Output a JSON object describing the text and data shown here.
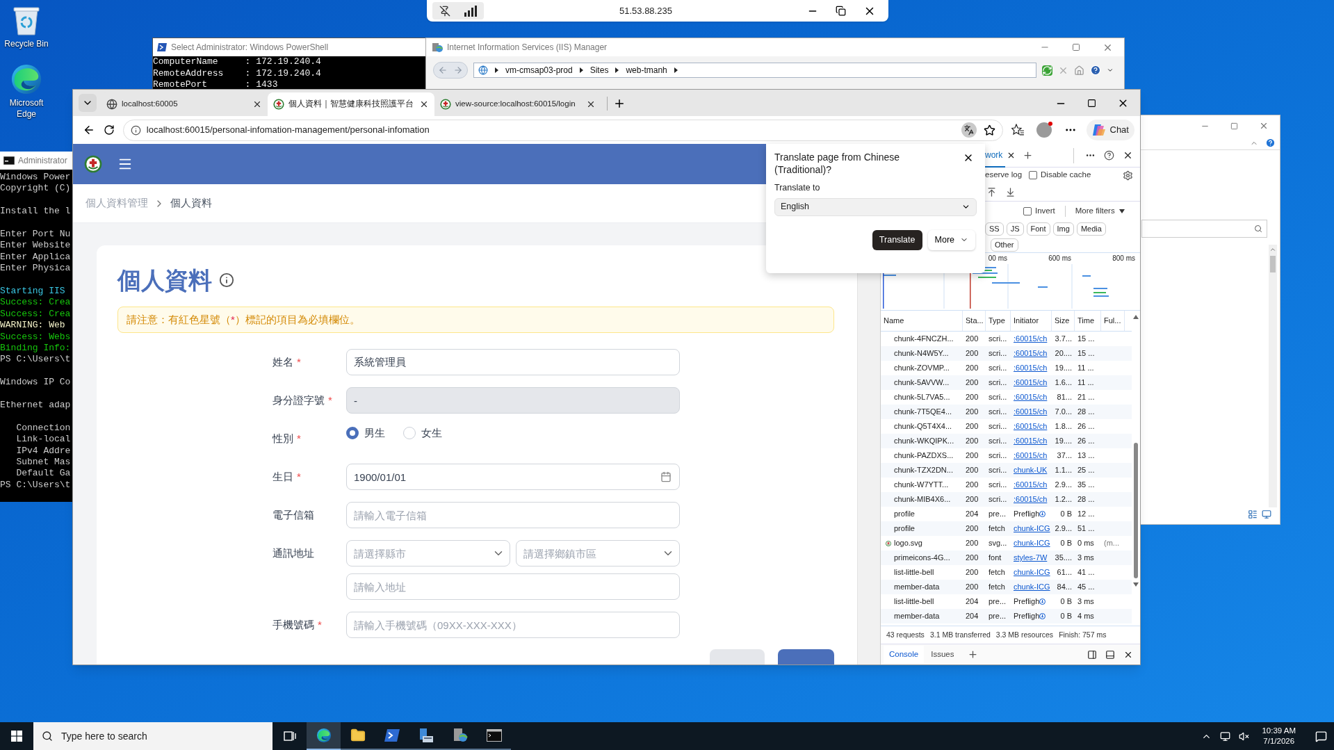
{
  "remote_bar": {
    "address": "51.53.88.235"
  },
  "desktop_icons": [
    {
      "label": "Recycle Bin",
      "kind": "recycle"
    },
    {
      "label": "Microsoft Edge",
      "kind": "edge"
    }
  ],
  "powershell": {
    "title": "Select Administrator: Windows PowerShell",
    "lines": [
      "ComputerName     : 172.19.240.4",
      "RemoteAddress    : 172.19.240.4",
      "RemotePort       : 1433"
    ]
  },
  "iis": {
    "title": "Internet Information Services (IIS) Manager",
    "path": [
      "vm-cmsap03-prod",
      "Sites",
      "web-tmanh"
    ]
  },
  "cmd": {
    "title": "Administrator",
    "blocks": [
      {
        "lines": [
          {
            "text": "Windows Power",
            "color": "#cccccc"
          },
          {
            "text": "Copyright (C)",
            "color": "#cccccc"
          }
        ]
      },
      {
        "lines": [
          {
            "text": "Install the l",
            "color": "#cccccc"
          }
        ]
      },
      {
        "lines": [
          {
            "text": "Enter Port Nu",
            "color": "#cccccc"
          },
          {
            "text": "Enter Website",
            "color": "#cccccc"
          },
          {
            "text": "Enter Applica",
            "color": "#cccccc"
          },
          {
            "text": "Enter Physica",
            "color": "#cccccc"
          }
        ]
      },
      {
        "lines": [
          {
            "text": "Starting IIS",
            "color": "#3ac7e4"
          },
          {
            "text": "Success: Crea",
            "color": "#16c60c"
          },
          {
            "text": "Success: Crea",
            "color": "#16c60c"
          },
          {
            "text": "WARNING: Web",
            "color": "#f2f0c8"
          },
          {
            "text": "Success: Webs",
            "color": "#16c60c"
          },
          {
            "text": "Binding Info:",
            "color": "#16c60c"
          },
          {
            "text": "PS C:\\Users\\t",
            "color": "#cccccc"
          }
        ]
      },
      {
        "lines": [
          {
            "text": "Windows IP Co",
            "color": "#cccccc"
          }
        ]
      },
      {
        "lines": [
          {
            "text": "Ethernet adap",
            "color": "#cccccc"
          }
        ]
      },
      {
        "lines": [
          {
            "text": "   Connection",
            "color": "#cccccc"
          },
          {
            "text": "   Link-local",
            "color": "#cccccc"
          },
          {
            "text": "   IPv4 Addre",
            "color": "#cccccc"
          },
          {
            "text": "   Subnet Mas",
            "color": "#cccccc"
          },
          {
            "text": "   Default Ga",
            "color": "#cccccc"
          },
          {
            "text": "PS C:\\Users\\t",
            "color": "#cccccc"
          }
        ]
      }
    ]
  },
  "browser": {
    "tabs": [
      {
        "title": "localhost:60005",
        "selected": false
      },
      {
        "title": "個人資料｜智慧健康科技照護平台",
        "selected": true
      },
      {
        "title": "view-source:localhost:60015/login",
        "selected": false
      }
    ],
    "url": "localhost:60015/personal-infomation-management/personal-infomation",
    "chat": "Chat"
  },
  "page": {
    "breadcrumb": [
      {
        "label": "個人資料管理",
        "selected": false
      },
      {
        "label": "個人資料",
        "selected": true
      }
    ],
    "title": "個人資料",
    "notice": {
      "before": "請注意：有紅色星號（",
      "mark": "*",
      "after": "）標記的項目為必填欄位。"
    },
    "fields": [
      {
        "label": "姓名",
        "mark": "*",
        "kind": "text",
        "value": "系統管理員",
        "disabled": false
      },
      {
        "label": "身分證字號",
        "mark": "*",
        "kind": "text",
        "value": "-",
        "disabled": true
      },
      {
        "label": "性別",
        "mark": "*",
        "kind": "radio",
        "options": [
          {
            "label": "男生",
            "selected": true
          },
          {
            "label": "女生",
            "selected": false
          }
        ]
      },
      {
        "label": "生日",
        "mark": "*",
        "kind": "date",
        "value": "1900/01/01"
      },
      {
        "label": "電子信箱",
        "kind": "text",
        "placeholder": "請輸入電子信箱",
        "disabled": false
      },
      {
        "label": "通訊地址",
        "kind": "address",
        "selects": [
          {
            "placeholder": "請選擇縣市"
          },
          {
            "placeholder": "請選擇鄉鎮市區"
          }
        ],
        "placeholder": "請輸入地址"
      },
      {
        "label": "手機號碼",
        "mark": "*",
        "kind": "text",
        "placeholder": "請輸入手機號碼（09XX-XXX-XXX）",
        "disabled": false
      }
    ]
  },
  "translate": {
    "title": "Translate page from Chinese (Traditional)?",
    "label": "Translate to",
    "language": "English",
    "primary": "Translate",
    "more": "More"
  },
  "devtools": {
    "tab": "work",
    "preserve_log": "eserve log",
    "disable_cache": {
      "label": "Disable cache",
      "checked": false
    },
    "invert": {
      "label": "Invert",
      "checked": false
    },
    "more_filters": "More filters",
    "chips": [
      "SS",
      "JS",
      "Font",
      "Img",
      "Media"
    ],
    "chips2": [
      "Other"
    ],
    "timeline_labels": [
      "00 ms",
      "600 ms",
      "800 ms"
    ],
    "columns": [
      "Name",
      "Sta...",
      "Type",
      "Initiator",
      "Size",
      "Time",
      "Ful..."
    ],
    "rows": [
      {
        "kind": "script",
        "name": "chunk-4FNCZH...",
        "status": "200",
        "type": "scri...",
        "initiator": ":60015/ch",
        "size": "3.7...",
        "time": "15 ..."
      },
      {
        "kind": "script",
        "name": "chunk-N4W5Y...",
        "status": "200",
        "type": "scri...",
        "initiator": ":60015/ch",
        "size": "20....",
        "time": "15 ..."
      },
      {
        "kind": "script",
        "name": "chunk-ZOVMP...",
        "status": "200",
        "type": "scri...",
        "initiator": ":60015/ch",
        "size": "19....",
        "time": "11 ..."
      },
      {
        "kind": "script",
        "name": "chunk-5AVVW...",
        "status": "200",
        "type": "scri...",
        "initiator": ":60015/ch",
        "size": "1.6...",
        "time": "11 ..."
      },
      {
        "kind": "script",
        "name": "chunk-5L7VA5...",
        "status": "200",
        "type": "scri...",
        "initiator": ":60015/ch",
        "size": "81...",
        "time": "21 ..."
      },
      {
        "kind": "script",
        "name": "chunk-7T5QE4...",
        "status": "200",
        "type": "scri...",
        "initiator": ":60015/ch",
        "size": "7.0...",
        "time": "28 ..."
      },
      {
        "kind": "script",
        "name": "chunk-Q5T4X4...",
        "status": "200",
        "type": "scri...",
        "initiator": ":60015/ch",
        "size": "1.8...",
        "time": "26 ..."
      },
      {
        "kind": "script",
        "name": "chunk-WKQIPK...",
        "status": "200",
        "type": "scri...",
        "initiator": ":60015/ch",
        "size": "19....",
        "time": "26 ..."
      },
      {
        "kind": "script",
        "name": "chunk-PAZDXS...",
        "status": "200",
        "type": "scri...",
        "initiator": ":60015/ch",
        "size": "37...",
        "time": "13 ..."
      },
      {
        "kind": "script",
        "name": "chunk-TZX2DN...",
        "status": "200",
        "type": "scri...",
        "initiator": "chunk-UK",
        "size": "1.1...",
        "time": "25 ..."
      },
      {
        "kind": "script",
        "name": "chunk-W7YTT...",
        "status": "200",
        "type": "scri...",
        "initiator": ":60015/ch",
        "size": "2.9...",
        "time": "35 ..."
      },
      {
        "kind": "script",
        "name": "chunk-MIB4X6...",
        "status": "200",
        "type": "scri...",
        "initiator": ":60015/ch",
        "size": "1.2...",
        "time": "28 ..."
      },
      {
        "kind": "preflight",
        "name": "profile",
        "status": "204",
        "type": "pre...",
        "initiator": "Prefligh",
        "size": "0 B",
        "time": "12 ..."
      },
      {
        "kind": "script",
        "name": "profile",
        "status": "200",
        "type": "fetch",
        "initiator": "chunk-ICG",
        "size": "2.9...",
        "time": "51 ..."
      },
      {
        "kind": "image",
        "name": "logo.svg",
        "status": "200",
        "type": "svg...",
        "initiator": "chunk-ICG",
        "size": "0 B",
        "time": "0 ms",
        "full": "(m..."
      },
      {
        "kind": "script",
        "name": "primeicons-4G...",
        "status": "200",
        "type": "font",
        "initiator": "styles-7W",
        "size": "35....",
        "time": "3 ms"
      },
      {
        "kind": "script",
        "name": "list-little-bell",
        "status": "200",
        "type": "fetch",
        "initiator": "chunk-ICG",
        "size": "61...",
        "time": "41 ..."
      },
      {
        "kind": "script",
        "name": "member-data",
        "status": "200",
        "type": "fetch",
        "initiator": "chunk-ICG",
        "size": "84...",
        "time": "45 ..."
      },
      {
        "kind": "preflight",
        "name": "list-little-bell",
        "status": "204",
        "type": "pre...",
        "initiator": "Prefligh",
        "size": "0 B",
        "time": "3 ms"
      },
      {
        "kind": "preflight",
        "name": "member-data",
        "status": "204",
        "type": "pre...",
        "initiator": "Prefligh",
        "size": "0 B",
        "time": "4 ms"
      }
    ],
    "summary": [
      "43 requests",
      "3.1 MB transferred",
      "3.3 MB resources",
      "Finish: 757 ms"
    ],
    "drawer_tabs": [
      {
        "label": "Console",
        "selected": true
      },
      {
        "label": "Issues",
        "selected": false
      }
    ]
  },
  "taskbar": {
    "search_placeholder": "Type here to search",
    "apps": [
      {
        "kind": "taskview",
        "selected": false
      },
      {
        "kind": "browser",
        "selected": true
      },
      {
        "kind": "folder",
        "selected": false
      },
      {
        "kind": "shell",
        "selected": false
      },
      {
        "kind": "server",
        "selected": false
      },
      {
        "kind": "iis",
        "selected": false
      },
      {
        "kind": "console",
        "selected": false
      }
    ],
    "time": "10:39 AM",
    "date": "7/1/2026"
  }
}
